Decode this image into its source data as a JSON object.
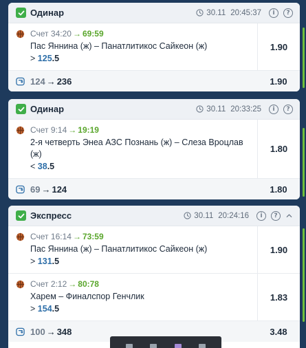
{
  "cards": [
    {
      "title": "Одинар",
      "date": "30.11",
      "time": "20:45:37",
      "info_icon": "i",
      "help_icon": "?",
      "bets": [
        {
          "score_label": "Счет",
          "score_old": "34:20",
          "score_new": "69:59",
          "event": "Пас Яннина (ж) – Панатлитикос Сайкеон (ж)",
          "pick_sign": ">",
          "pick_main": "125",
          "pick_frac": ".5",
          "odds": "1.90"
        }
      ],
      "footer": {
        "from": "124",
        "to": "236",
        "odds": "1.90"
      }
    },
    {
      "title": "Одинар",
      "date": "30.11",
      "time": "20:33:25",
      "info_icon": "i",
      "help_icon": "?",
      "bets": [
        {
          "score_label": "Счет",
          "score_old": "9:14",
          "score_new": "19:19",
          "event": "2-я четверть Энеа АЗС Познань (ж) – Слеза Вроцлав (ж)",
          "pick_sign": "<",
          "pick_main": "38",
          "pick_frac": ".5",
          "odds": "1.80"
        }
      ],
      "footer": {
        "from": "69",
        "to": "124",
        "odds": "1.80"
      }
    },
    {
      "title": "Экспресс",
      "date": "30.11",
      "time": "20:24:16",
      "info_icon": "i",
      "help_icon": "?",
      "bets": [
        {
          "score_label": "Счет",
          "score_old": "16:14",
          "score_new": "73:59",
          "event": "Пас Яннина (ж) – Панатлитикос Сайкеон (ж)",
          "pick_sign": ">",
          "pick_main": "131",
          "pick_frac": ".5",
          "odds": "1.90"
        },
        {
          "score_label": "Счет",
          "score_old": "2:12",
          "score_new": "80:78",
          "event": "Харем – Финалспор Генчлик",
          "pick_sign": ">",
          "pick_main": "154",
          "pick_frac": ".5",
          "odds": "1.83"
        }
      ],
      "footer": {
        "from": "100",
        "to": "348",
        "odds": "3.48"
      }
    }
  ],
  "arrow_glyph": "→",
  "colors": {
    "background": "#1e3a5c",
    "check_green": "#3fae49",
    "score_green": "#5aa62c",
    "pick_blue": "#2d6ea8"
  },
  "icons": {
    "check": "check-icon",
    "clock": "clock-icon",
    "ball": "basketball-icon",
    "coin": "coin-icon",
    "info": "info-icon",
    "help": "help-icon",
    "collapse": "chevron-up-icon"
  }
}
